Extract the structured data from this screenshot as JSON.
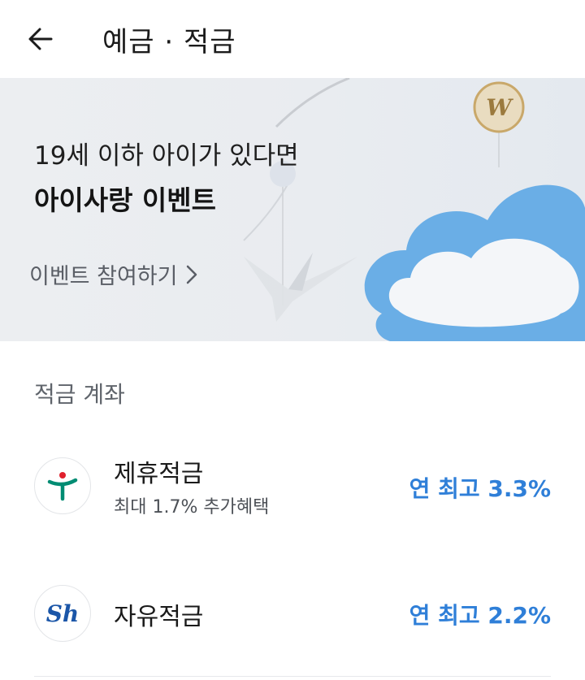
{
  "header": {
    "title": "예금 · 적금"
  },
  "banner": {
    "subtitle": "19세 이하 아이가 있다면",
    "title": "아이사랑 이벤트",
    "link_label": "이벤트 참여하기"
  },
  "savings": {
    "section_title": "적금 계좌",
    "items": [
      {
        "name": "제휴적금",
        "desc": "최대 1.7% 추가혜택",
        "rate": "연 최고 3.3%",
        "bank_logo": "hana-bank-logo"
      },
      {
        "name": "자유적금",
        "rate": "연 최고 2.2%",
        "bank_logo": "shinhan-bank-logo",
        "logo_text": "Sh"
      }
    ]
  },
  "colors": {
    "accent": "#2f7fd8",
    "banner_bg": "#eceef1",
    "hana_green": "#008c73",
    "hana_red": "#e0202d",
    "shinhan_blue": "#1b56a8"
  }
}
